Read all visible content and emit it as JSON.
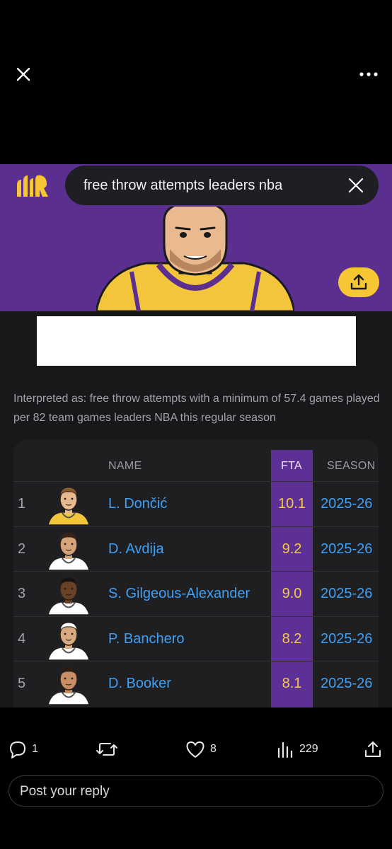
{
  "search": {
    "query": "free throw attempts leaders nba"
  },
  "interpretation": "Interpreted as: free throw attempts with a minimum of 57.4 games played per 82 team games leaders NBA this regular season",
  "table": {
    "headers": {
      "name": "NAME",
      "stat": "FTA",
      "season": "SEASON"
    },
    "rows": [
      {
        "rank": "1",
        "name": "L. Dončić",
        "fta": "10.1",
        "season": "2025-26",
        "jersey_color": "#f3c53a",
        "skin": "#e9b98f",
        "hair": "#8a5a2b"
      },
      {
        "rank": "2",
        "name": "D. Avdija",
        "fta": "9.2",
        "season": "2025-26",
        "jersey_color": "#ffffff",
        "skin": "#d7a47a",
        "hair": "#3a2516"
      },
      {
        "rank": "3",
        "name": "S. Gilgeous-Alexander",
        "fta": "9.0",
        "season": "2025-26",
        "jersey_color": "#ffffff",
        "skin": "#6b4127",
        "hair": "#1b120d"
      },
      {
        "rank": "4",
        "name": "P. Banchero",
        "fta": "8.2",
        "season": "2025-26",
        "jersey_color": "#ffffff",
        "skin": "#d9a97f",
        "hair": "#ffffff"
      },
      {
        "rank": "5",
        "name": "D. Booker",
        "fta": "8.1",
        "season": "2025-26",
        "jersey_color": "#ffffff",
        "skin": "#c98e65",
        "hair": "#2a1b12"
      }
    ]
  },
  "actions": {
    "replies": "1",
    "reposts": "",
    "likes": "8",
    "views": "229"
  },
  "reply": {
    "placeholder": "Post your reply"
  },
  "colors": {
    "brand_purple": "#5b2f90",
    "accent_yellow": "#f6c634",
    "link_blue": "#3ea0f5"
  }
}
